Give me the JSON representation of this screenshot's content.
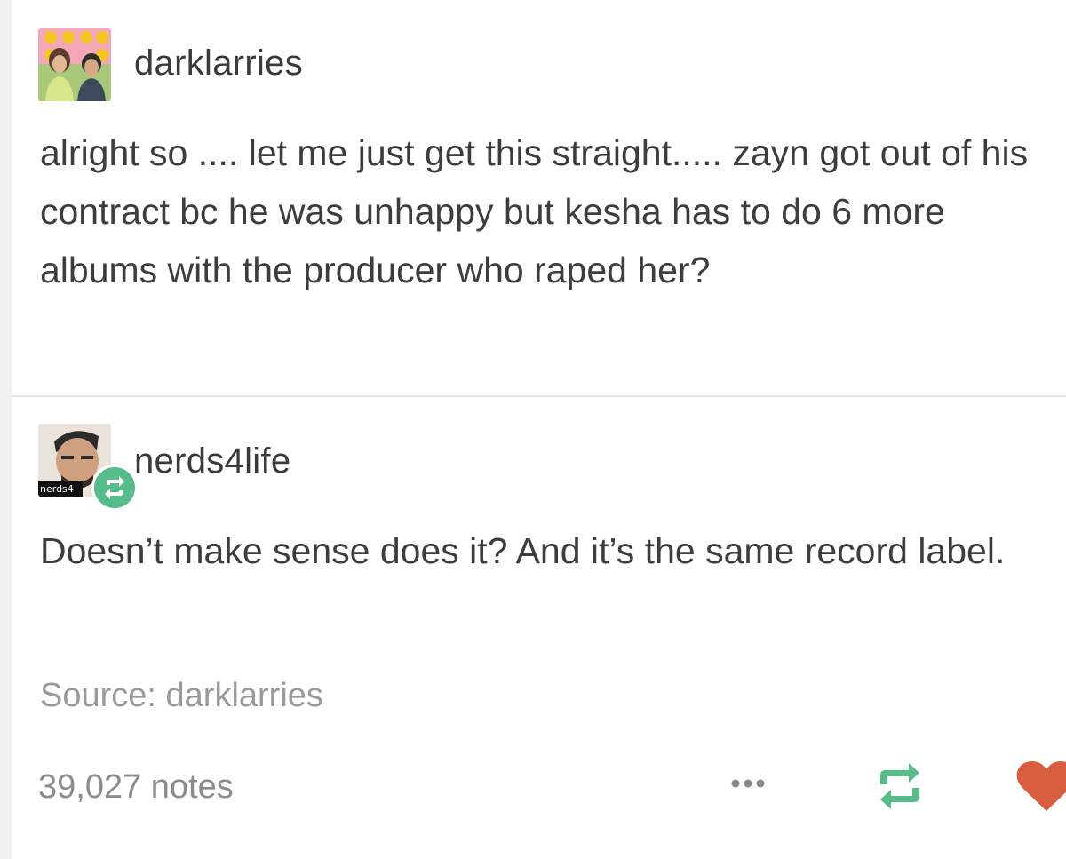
{
  "post": {
    "author": "darklarries",
    "text": "alright so .... let me just get this straight..... zayn got out of his contract bc he was unhappy but kesha has to do 6 more albums with the producer who raped her?"
  },
  "reply": {
    "author": "nerds4life",
    "avatar_caption": "nerds4",
    "text": "Doesn’t make sense does it? And it’s the same record label."
  },
  "footer": {
    "source": "Source: darklarries",
    "notes": "39,027 notes",
    "icons": [
      "more-icon",
      "reblog-icon",
      "heart-icon"
    ]
  },
  "colors": {
    "reblog_green": "#56bc8a",
    "heart_red": "#d95e40",
    "text": "#3d3d3d",
    "muted": "#9a9a9a"
  }
}
